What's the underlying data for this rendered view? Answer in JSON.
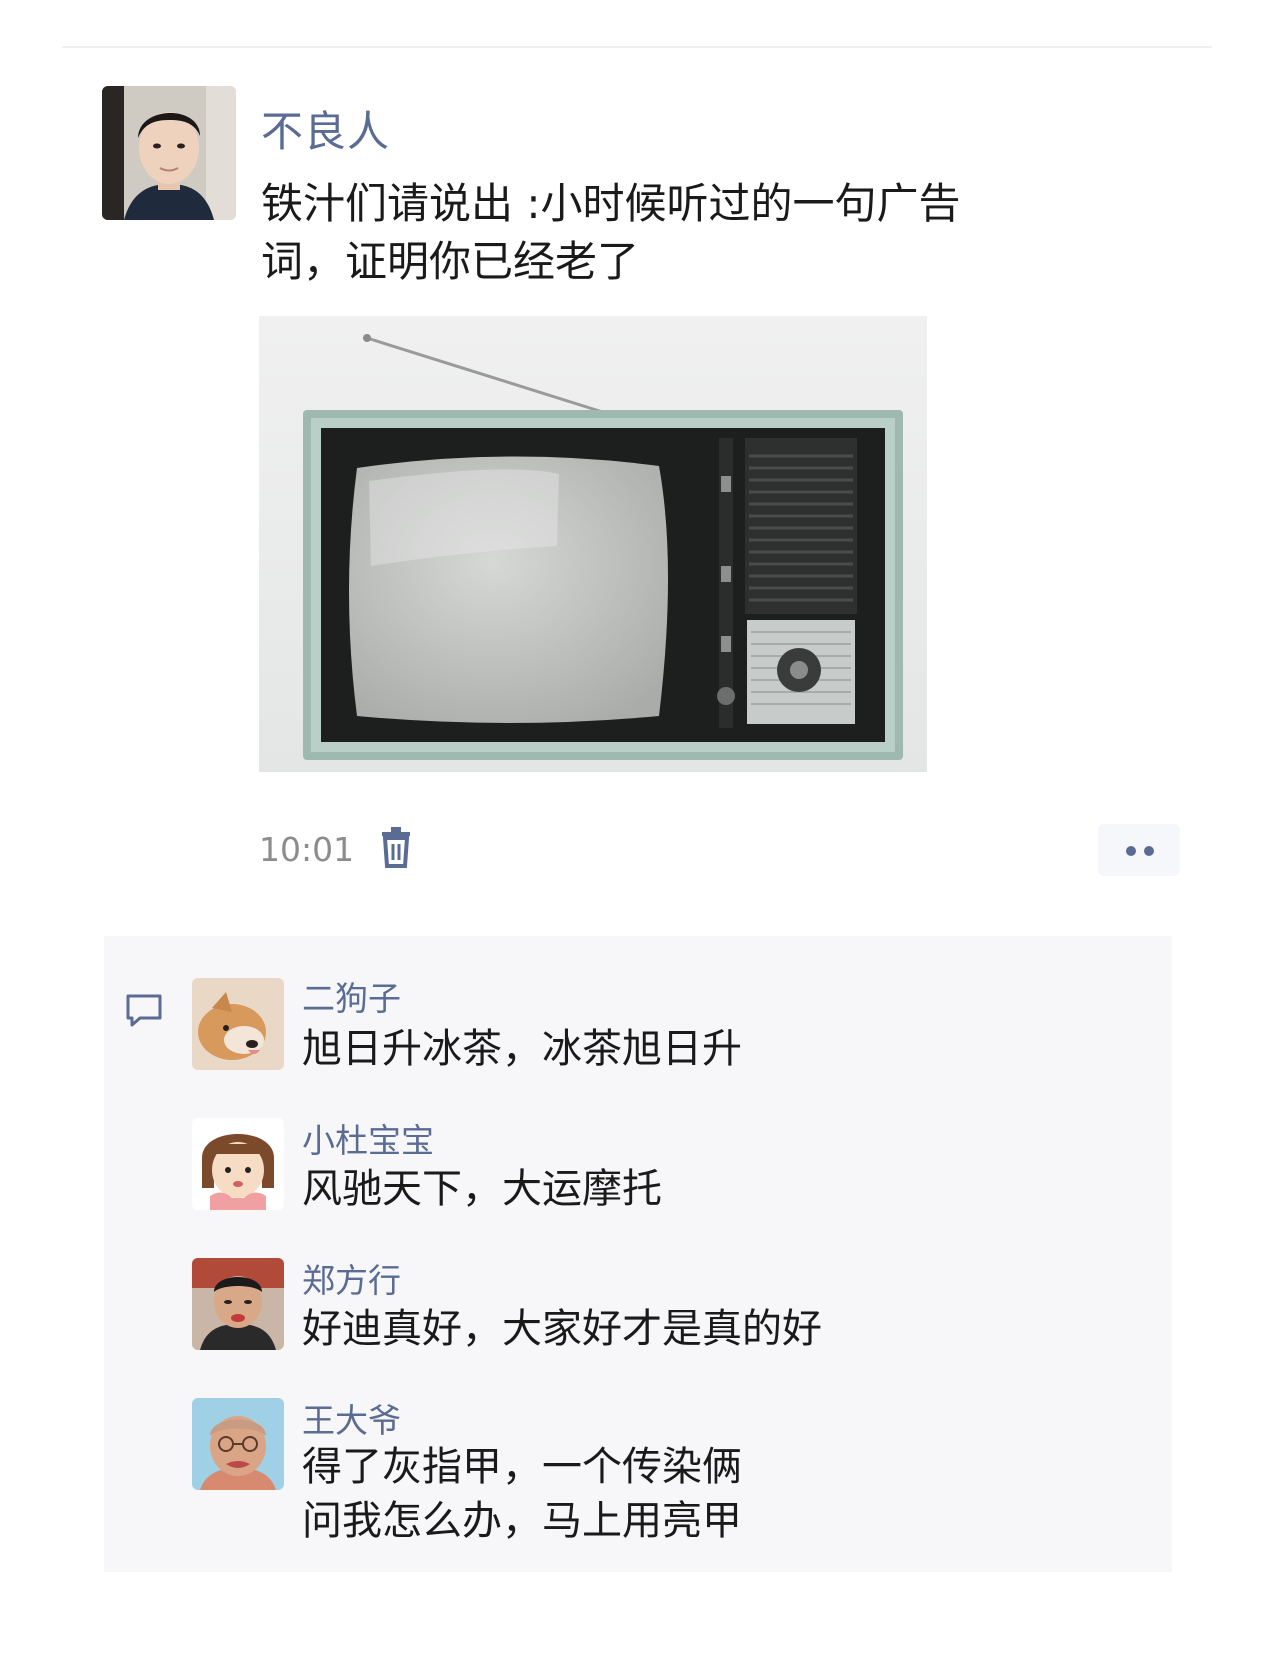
{
  "post": {
    "author": "不良人",
    "text_lines": [
      "铁汁们请说出 :小时候听过的一句广告",
      "词，证明你已经老了"
    ],
    "time": "10:01"
  },
  "icons": {
    "delete": "trash-icon",
    "more": "more-dots-icon",
    "comment": "comment-bubble-icon"
  },
  "colors": {
    "name_link": "#5a6b94",
    "text": "#1a1a1a",
    "panel_bg": "#f7f7f9"
  },
  "comments": [
    {
      "name": "二狗子",
      "lines": [
        "旭日升冰茶，冰茶旭日升"
      ]
    },
    {
      "name": "小杜宝宝",
      "lines": [
        "风驰天下，大运摩托"
      ]
    },
    {
      "name": "郑方行",
      "lines": [
        "好迪真好，大家好才是真的好"
      ]
    },
    {
      "name": "王大爷",
      "lines": [
        "得了灰指甲，一个传染俩",
        "问我怎么办，马上用亮甲"
      ]
    }
  ]
}
